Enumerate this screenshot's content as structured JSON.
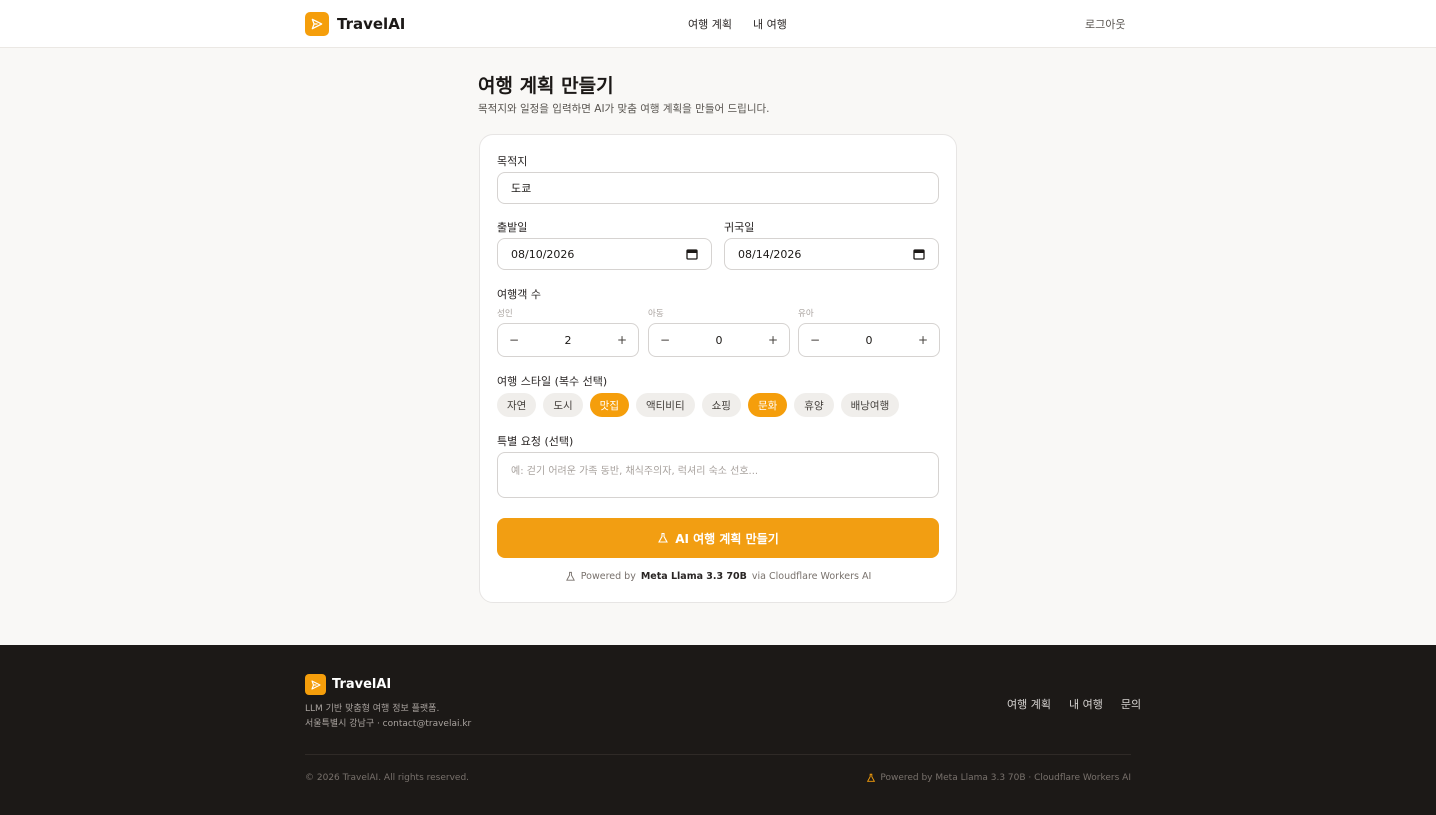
{
  "header": {
    "brand": "TravelAI",
    "nav": [
      "여행 계획",
      "내 여행"
    ],
    "logout": "로그아웃"
  },
  "main": {
    "title": "여행 계획 만들기",
    "subtitle": "목적지와 일정을 입력하면 AI가 맞춤 여행 계획을 만들어 드립니다."
  },
  "form": {
    "destination_label": "목적지",
    "destination_value": "도쿄",
    "departure_label": "출발일",
    "departure_value": "08/10/2026",
    "return_label": "귀국일",
    "return_value": "08/14/2026",
    "travelers_label": "여행객 수",
    "adults_label": "성인",
    "adults_value": "2",
    "children_label": "아동",
    "children_value": "0",
    "infants_label": "유아",
    "infants_value": "0",
    "minus": "−",
    "plus": "+",
    "style_label": "여행 스타일 (복수 선택)",
    "styles": [
      {
        "label": "자연",
        "active": false
      },
      {
        "label": "도시",
        "active": false
      },
      {
        "label": "맛집",
        "active": true
      },
      {
        "label": "액티비티",
        "active": false
      },
      {
        "label": "쇼핑",
        "active": false
      },
      {
        "label": "문화",
        "active": true
      },
      {
        "label": "휴양",
        "active": false
      },
      {
        "label": "배낭여행",
        "active": false
      }
    ],
    "request_label": "특별 요청 (선택)",
    "request_placeholder": "예: 걷기 어려운 가족 동반, 채식주의자, 럭셔리 숙소 선호...",
    "submit_label": "AI 여행 계획 만들기",
    "powered_prefix": "Powered by",
    "powered_model": "Meta Llama 3.3 70B",
    "powered_suffix": "via Cloudflare Workers AI"
  },
  "footer": {
    "brand": "TravelAI",
    "desc_line1": "LLM 기반 맞춤형 여행 정보 플랫폼.",
    "desc_line2": "서울특별시 강남구 · contact@travelai.kr",
    "nav": [
      "여행 계획",
      "내 여행",
      "문의"
    ],
    "copyright": "© 2026 TravelAI. All rights reserved.",
    "powered": "Powered by Meta Llama 3.3 70B · Cloudflare Workers AI"
  },
  "colors": {
    "accent": "#f59e0b",
    "footer_bg": "#1c1917"
  }
}
